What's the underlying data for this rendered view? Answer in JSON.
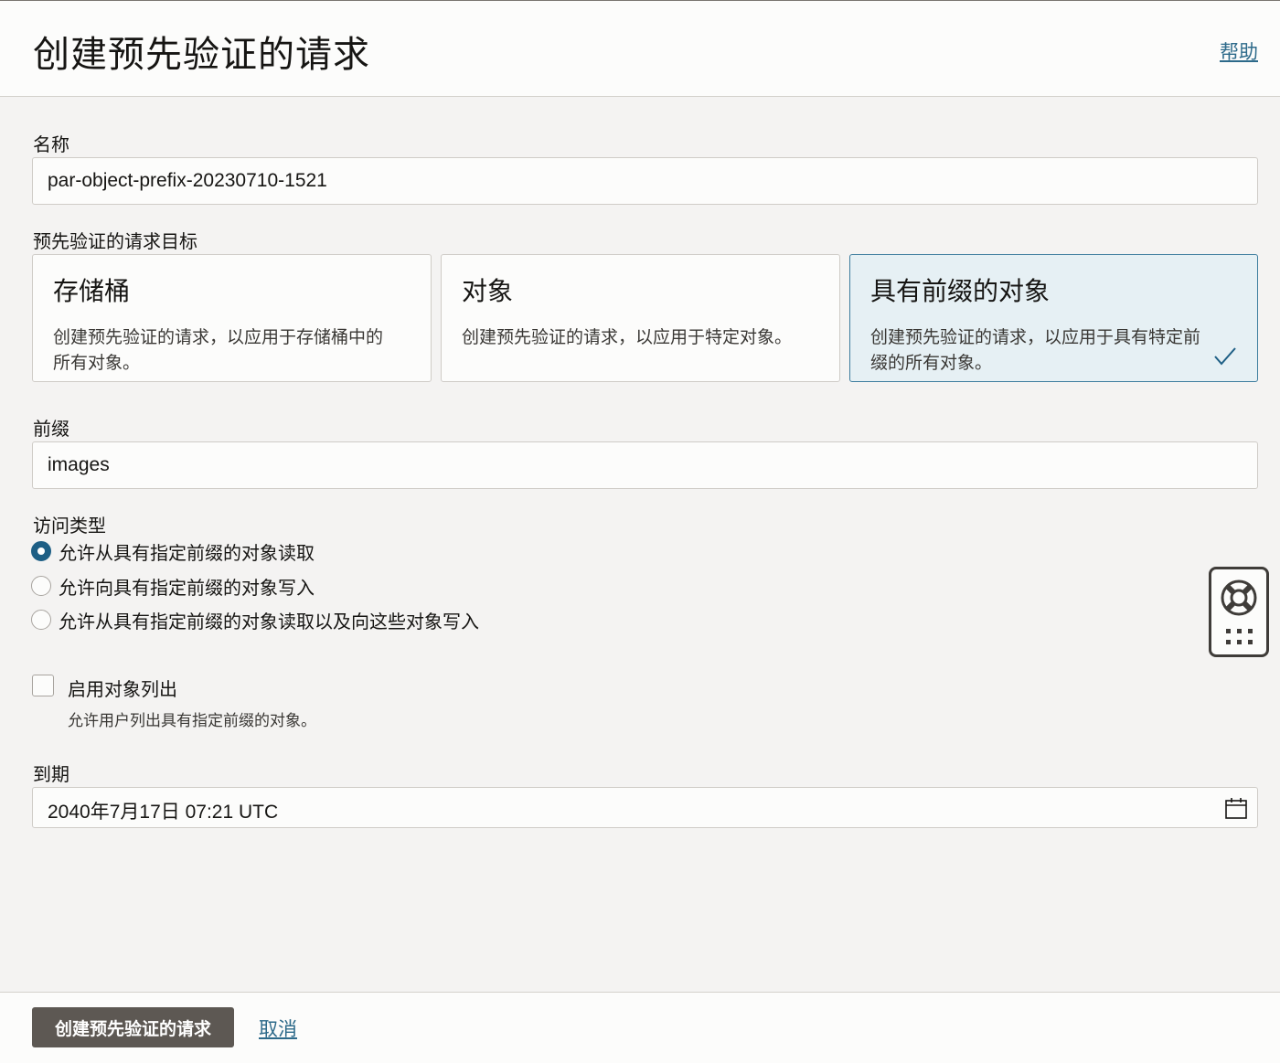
{
  "header": {
    "title": "创建预先验证的请求",
    "help_link": "帮助"
  },
  "form": {
    "name": {
      "label": "名称",
      "value": "par-object-prefix-20230710-1521"
    },
    "target": {
      "label": "预先验证的请求目标",
      "options": [
        {
          "title": "存储桶",
          "description": "创建预先验证的请求，以应用于存储桶中的所有对象。",
          "selected": false
        },
        {
          "title": "对象",
          "description": "创建预先验证的请求，以应用于特定对象。",
          "selected": false
        },
        {
          "title": "具有前缀的对象",
          "description": "创建预先验证的请求，以应用于具有特定前缀的所有对象。",
          "selected": true
        }
      ]
    },
    "prefix": {
      "label": "前缀",
      "value": "images"
    },
    "access_type": {
      "label": "访问类型",
      "options": [
        {
          "label": "允许从具有指定前缀的对象读取",
          "checked": true
        },
        {
          "label": "允许向具有指定前缀的对象写入",
          "checked": false
        },
        {
          "label": "允许从具有指定前缀的对象读取以及向这些对象写入",
          "checked": false
        }
      ]
    },
    "object_listing": {
      "label": "启用对象列出",
      "help": "允许用户列出具有指定前缀的对象。",
      "checked": false
    },
    "expiration": {
      "label": "到期",
      "value": "2040年7月17日 07:21 UTC"
    }
  },
  "footer": {
    "create_button": "创建预先验证的请求",
    "cancel_link": "取消"
  },
  "icons": {
    "selected_check": "checkmark-icon",
    "calendar": "calendar-icon",
    "help_widget": "lifebuoy-icon",
    "apps": "apps-grid-icon"
  },
  "colors": {
    "accent": "#1e5f85",
    "link": "#2d6a8a",
    "selected_card_bg": "#e6f0f4",
    "primary_button": "#5d5853"
  }
}
